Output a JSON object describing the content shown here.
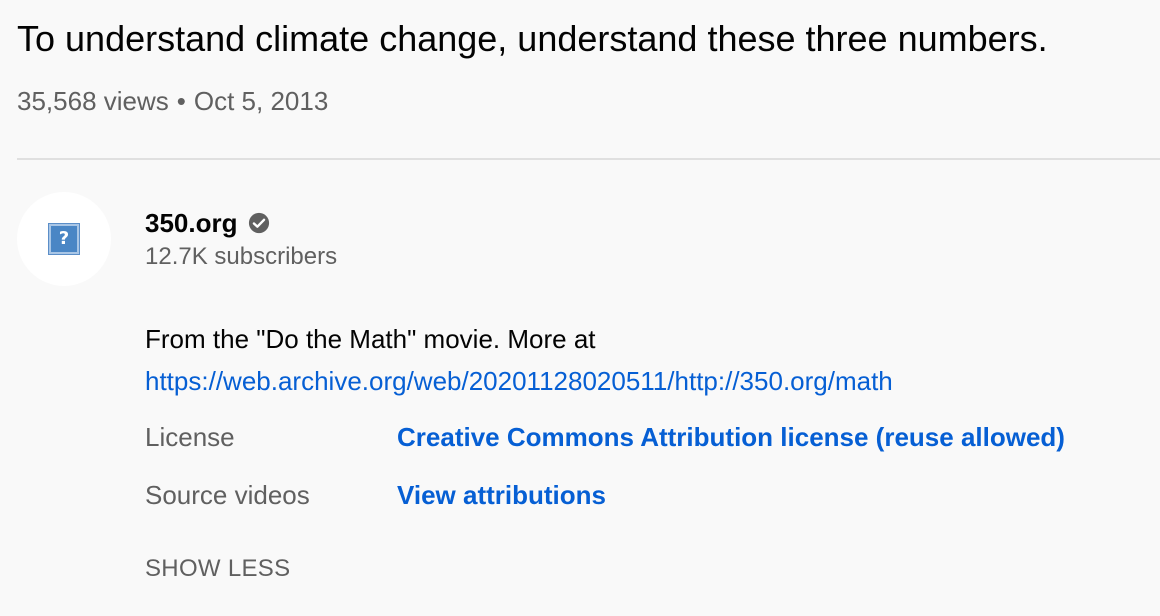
{
  "video": {
    "title": "To understand climate change, understand these three numbers.",
    "views": "35,568 views",
    "separator": "•",
    "date": "Oct 5, 2013"
  },
  "channel": {
    "name": "350.org",
    "verified_icon": "verified-check-icon",
    "subscribers": "12.7K subscribers",
    "avatar_icon": "broken-image-icon",
    "avatar_glyph": "?"
  },
  "description": {
    "text": "From the \"Do the Math\" movie. More at",
    "link": "https://web.archive.org/web/20201128020511/http://350.org/math"
  },
  "metadata": {
    "license_label": "License",
    "license_value": "Creative Commons Attribution license (reuse allowed)",
    "source_label": "Source videos",
    "source_value": "View attributions"
  },
  "actions": {
    "show_less": "SHOW LESS"
  },
  "colors": {
    "link": "#065fd4",
    "secondary_text": "#606060",
    "primary_text": "#030303",
    "background": "#f9f9f9"
  }
}
